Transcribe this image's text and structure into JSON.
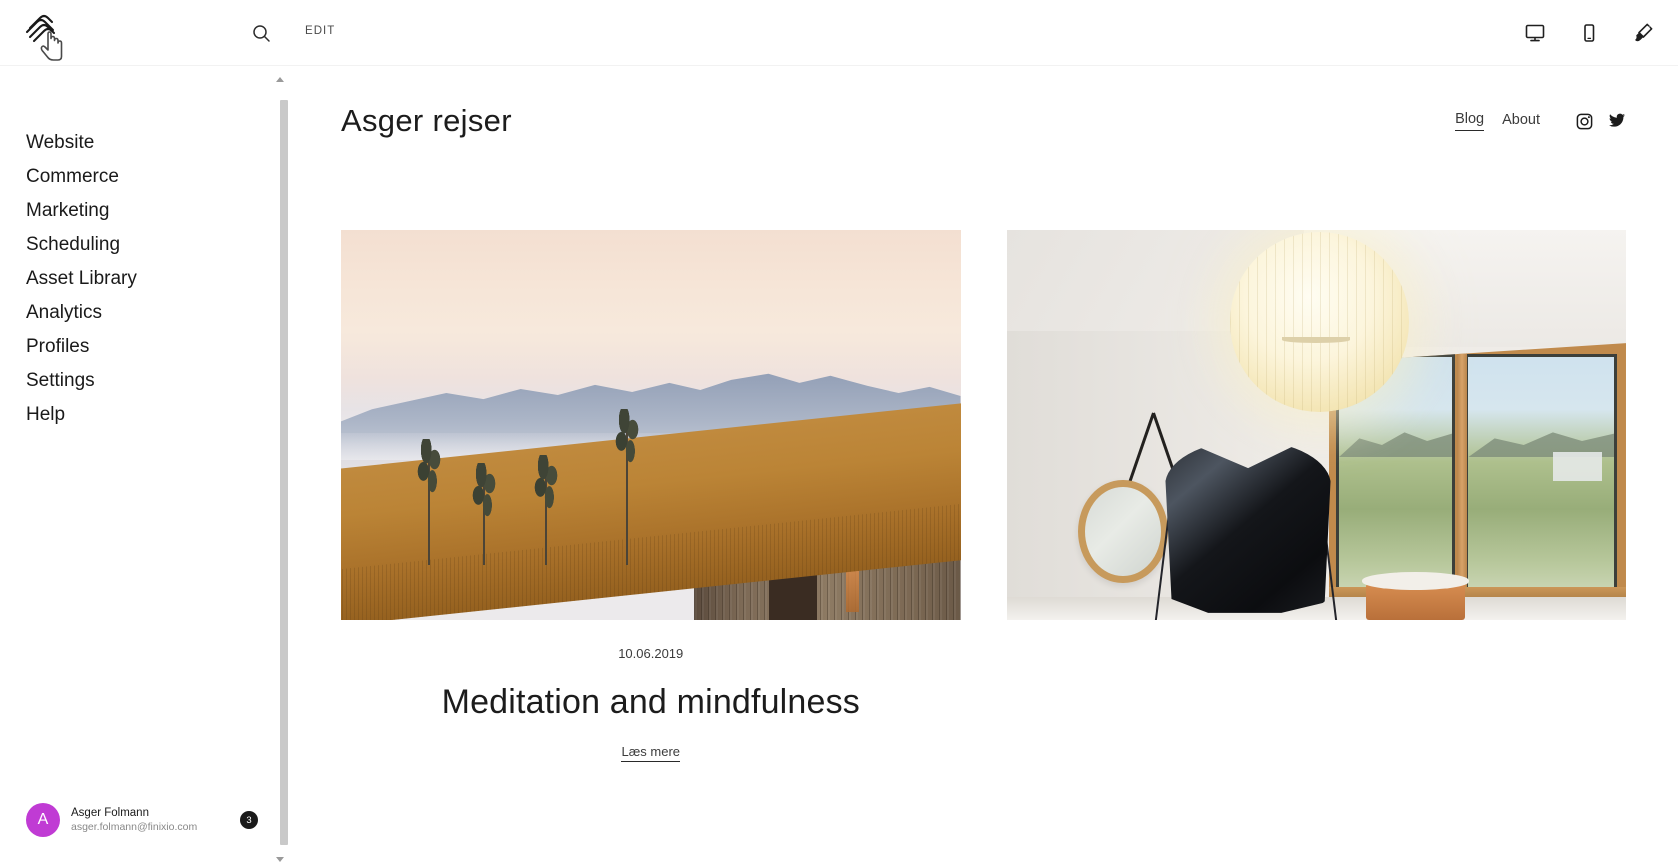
{
  "topbar": {
    "logo_name": "squarespace-logo",
    "cursor_name": "hand-cursor",
    "search_icon": "search-icon",
    "edit_label": "EDIT",
    "device_icons": [
      {
        "name": "desktop-icon",
        "label": "Desktop"
      },
      {
        "name": "mobile-icon",
        "label": "Mobile"
      },
      {
        "name": "paintbrush-icon",
        "label": "Design"
      }
    ]
  },
  "sidebar": {
    "items": [
      {
        "label": "Website"
      },
      {
        "label": "Commerce"
      },
      {
        "label": "Marketing"
      },
      {
        "label": "Scheduling"
      },
      {
        "label": "Asset Library"
      },
      {
        "label": "Analytics"
      },
      {
        "label": "Profiles"
      },
      {
        "label": "Settings"
      },
      {
        "label": "Help"
      }
    ],
    "user": {
      "avatar_initial": "A",
      "avatar_color": "#c03bd4",
      "name": "Asger Folmann",
      "email": "asger.folmann@finixio.com",
      "badge_count": "3"
    }
  },
  "scrollbar": {
    "up_arrow": "scroll-up-arrow",
    "down_arrow": "scroll-down-arrow"
  },
  "site": {
    "title": "Asger rejser",
    "nav": [
      {
        "label": "Blog",
        "active": true
      },
      {
        "label": "About",
        "active": false
      }
    ],
    "social": [
      {
        "name": "instagram-icon",
        "label": "Instagram"
      },
      {
        "name": "twitter-icon",
        "label": "Twitter"
      }
    ],
    "posts": [
      {
        "image_alt": "Sunset landscape with lake, mountains and wooden cabin in golden grass",
        "date": "10.06.2019",
        "title": "Meditation and mindfulness",
        "read_more": "Læs mere"
      },
      {
        "image_alt": "Bright interior with pendant lamp, round mirror, black leather chair and wooden windows",
        "date": "",
        "title": "",
        "read_more": ""
      }
    ]
  }
}
